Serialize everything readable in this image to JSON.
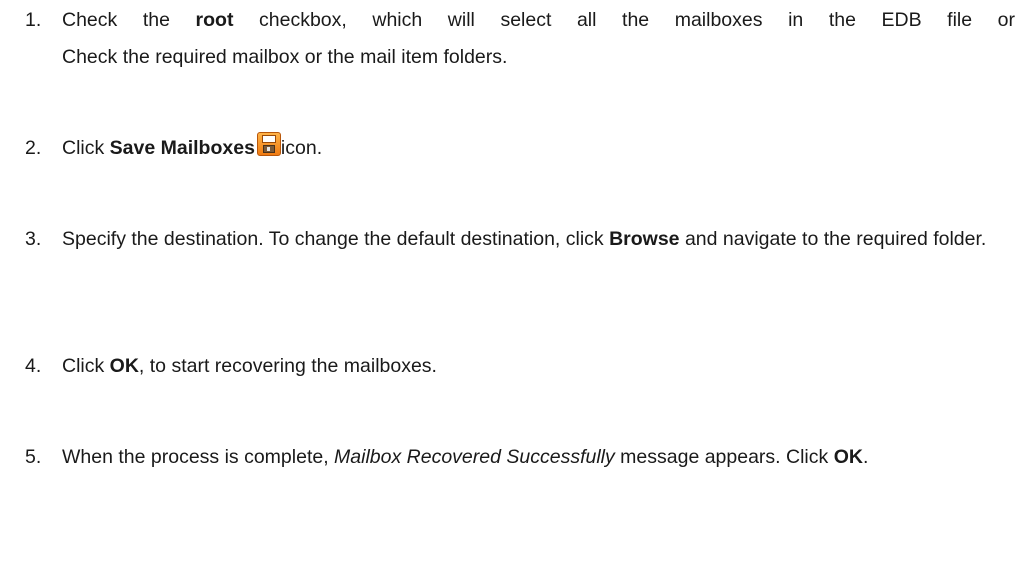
{
  "steps": [
    {
      "number": "1.",
      "line1_a": "Check the ",
      "line1_bold": "root",
      "line1_b": " checkbox, which will select all the mailboxes in the EDB file or",
      "line2": "Check the required mailbox or the mail item folders."
    },
    {
      "number": "2.",
      "text_a": "Click ",
      "bold": "Save Mailboxes",
      "icon": "save-floppy-icon",
      "text_b": "icon."
    },
    {
      "number": "3.",
      "text_a": "Specify the destination. To change the default destination, click ",
      "bold": "Browse",
      "text_b": " and navigate to the required folder."
    },
    {
      "number": "4.",
      "text_a": "Click ",
      "bold": "OK",
      "text_b": ", to start recovering the mailboxes."
    },
    {
      "number": "5.",
      "text_a": "When the process is complete, ",
      "italic": "Mailbox Recovered Successfully",
      "text_b": " message appears. Click ",
      "bold": "OK",
      "text_c": "."
    }
  ]
}
